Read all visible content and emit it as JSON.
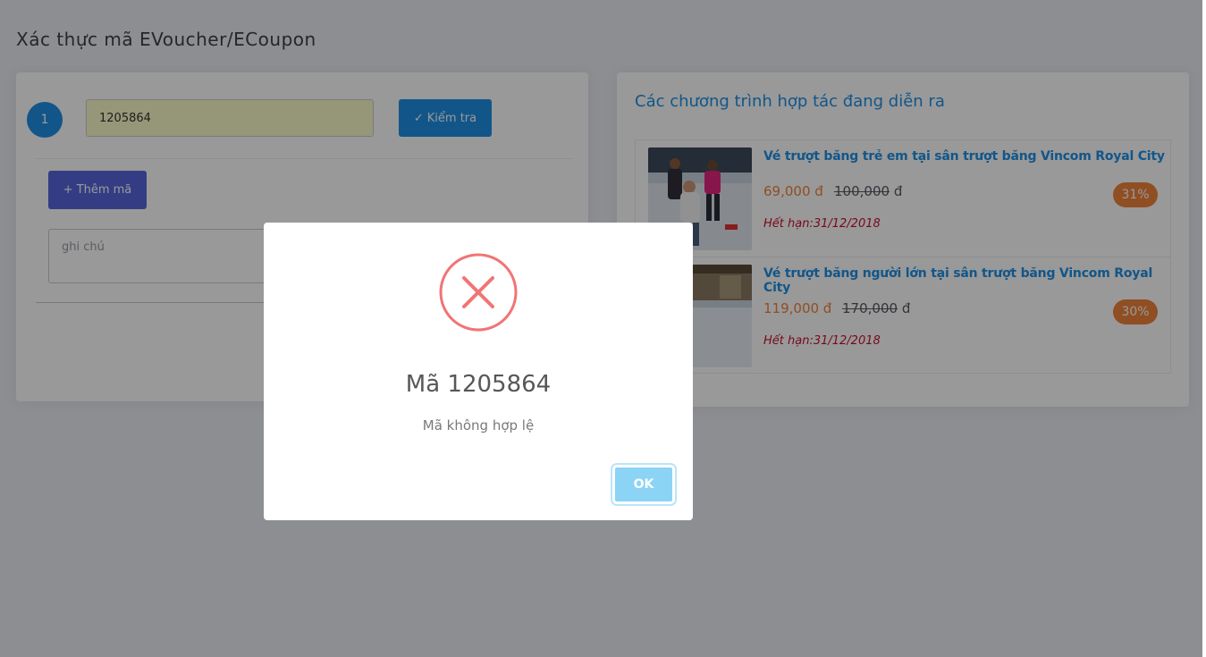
{
  "page": {
    "title": "Xác thực mã EVoucher/ECoupon"
  },
  "verify_form": {
    "row_number": "1",
    "code_value": "1205864",
    "check_button": "Kiểm tra",
    "add_button": "Thêm mã",
    "note_placeholder": "ghi chú"
  },
  "promotions": {
    "title": "Các chương trình hợp tác đang diễn ra",
    "items": [
      {
        "name": "Vé trượt băng trẻ em tại sân trượt băng Vincom Royal City",
        "price_new": "69,000 đ",
        "price_old": "100,000",
        "price_old_unit": "đ",
        "expiry": "Hết hạn:31/12/2018",
        "discount": "31%"
      },
      {
        "name": "Vé trượt băng người lớn tại sân trượt băng Vincom Royal City",
        "price_new": "119,000 đ",
        "price_old": "170,000",
        "price_old_unit": "đ",
        "expiry": "Hết hạn:31/12/2018",
        "discount": "30%"
      }
    ]
  },
  "modal": {
    "icon": "error-x-icon",
    "title": "Mã 1205864",
    "message": "Mã không hợp lệ",
    "ok_button": "OK"
  },
  "colors": {
    "primary": "#1f8fe5",
    "add_button": "#5867dd",
    "discount_badge": "#f0823b",
    "error_icon": "#f27474",
    "ok_button": "#8cd4f5"
  }
}
